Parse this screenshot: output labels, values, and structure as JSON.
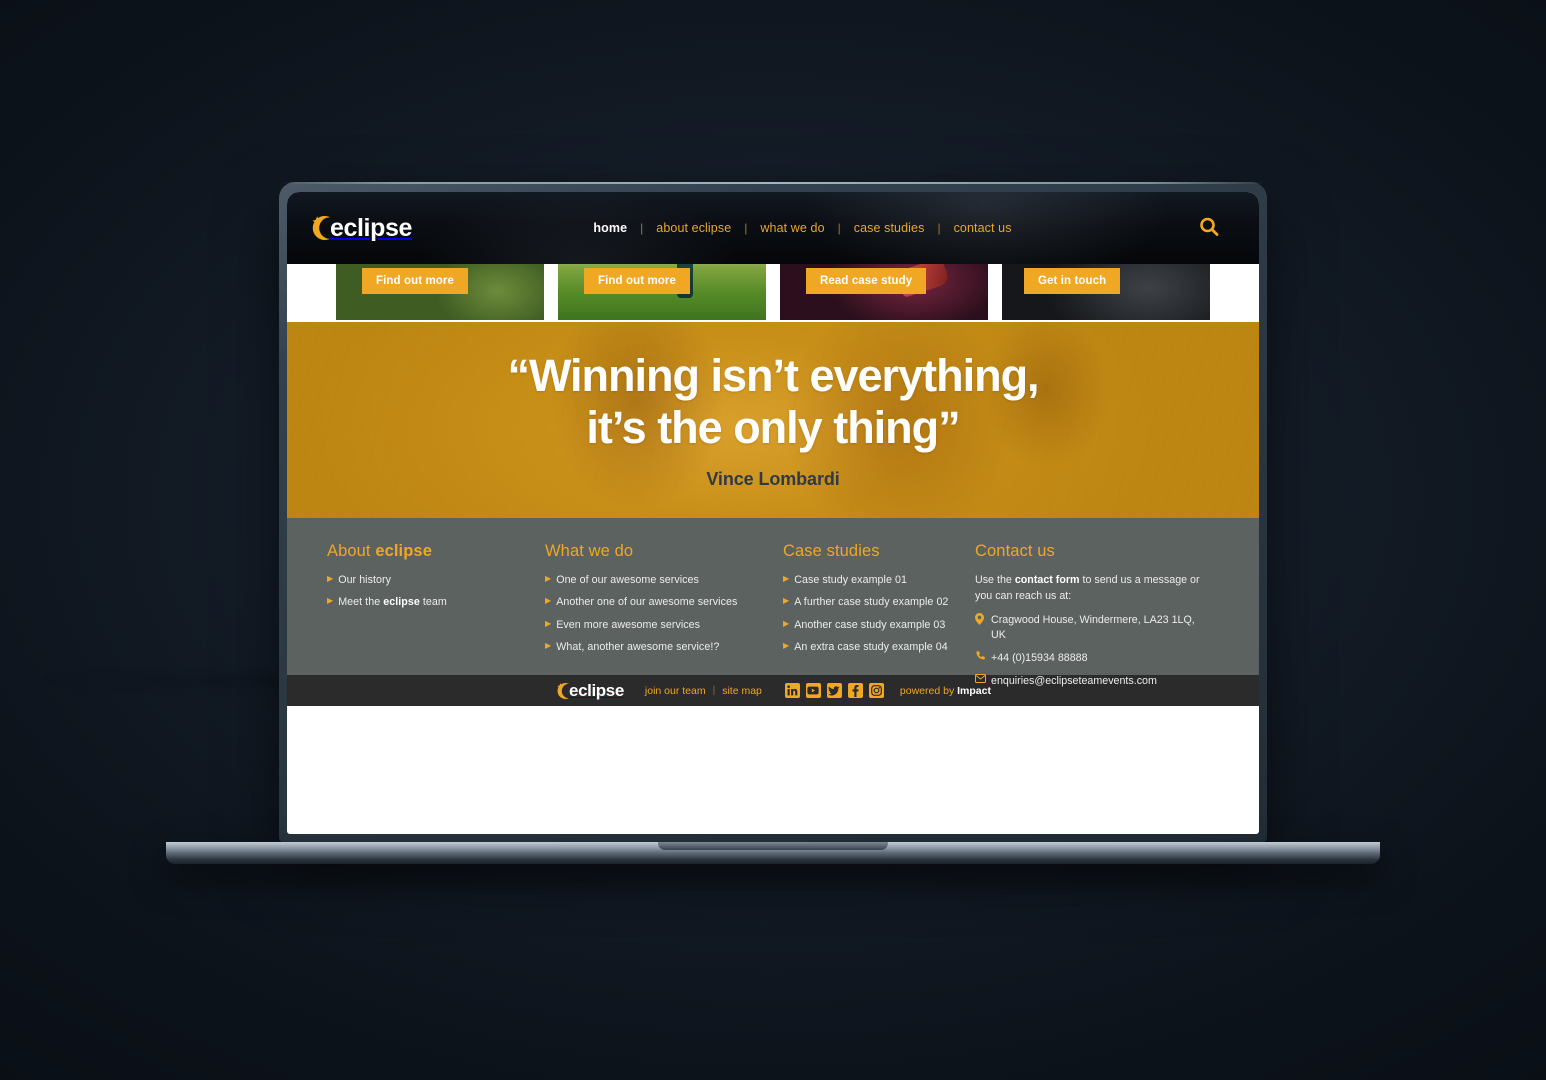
{
  "brand": {
    "name": "eclipse",
    "accent": "#efa724",
    "header_bg": "#0a0d12",
    "footer_bg": "#5c6260",
    "bottombar_bg": "#2b2b2b",
    "quote_band": "#c88f18"
  },
  "header": {
    "logo_text": "eclipse",
    "nav": [
      {
        "label": "home",
        "active": true
      },
      {
        "label": "about eclipse",
        "active": false
      },
      {
        "label": "what we do",
        "active": false
      },
      {
        "label": "case studies",
        "active": false
      },
      {
        "label": "contact us",
        "active": false
      }
    ],
    "separator": "|",
    "search_icon": "search-icon"
  },
  "cards": [
    {
      "button": "Find out more"
    },
    {
      "button": "Find out more"
    },
    {
      "button": "Read case study"
    },
    {
      "button": "Get in touch"
    }
  ],
  "quote": {
    "line1": "“Winning isn’t everything,",
    "line2": "it’s the only thing”",
    "author": "Vince Lombardi"
  },
  "footer": {
    "about": {
      "title_plain": "About ",
      "title_bold": "eclipse",
      "links": [
        {
          "pre": "Our history",
          "bold": "",
          "post": ""
        },
        {
          "pre": "Meet the ",
          "bold": "eclipse",
          "post": " team"
        }
      ]
    },
    "whatwedo": {
      "title": "What we do",
      "links": [
        "One of our awesome services",
        "Another one of our awesome services",
        "Even more awesome services",
        "What, another awesome service!?"
      ]
    },
    "cases": {
      "title": "Case studies",
      "links": [
        "Case study example 01",
        "A further case study example 02",
        "Another case study example 03",
        "An extra case study example 04"
      ]
    },
    "contact": {
      "title": "Contact us",
      "intro_pre": "Use the ",
      "intro_bold": "contact form",
      "intro_post": " to send us a message or you can reach us at:",
      "address": "Cragwood House, Windermere, LA23 1LQ, UK",
      "phone": "+44 (0)15934 88888",
      "email": "enquiries@eclipseteamevents.com",
      "address_icon": "map-pin-icon",
      "phone_icon": "phone-icon",
      "email_icon": "envelope-icon"
    }
  },
  "bottombar": {
    "logo_text": "eclipse",
    "links": [
      {
        "label": "join our team"
      },
      {
        "label": "site map"
      }
    ],
    "separator": "|",
    "socials": [
      {
        "name": "linkedin-icon",
        "glyph": "in"
      },
      {
        "name": "youtube-icon",
        "glyph": "▶"
      },
      {
        "name": "twitter-icon",
        "glyph": "ᵥ"
      },
      {
        "name": "facebook-icon",
        "glyph": "f"
      },
      {
        "name": "instagram-icon",
        "glyph": "▢"
      }
    ],
    "powered_pre": "powered by ",
    "powered_bold": "Impact"
  }
}
